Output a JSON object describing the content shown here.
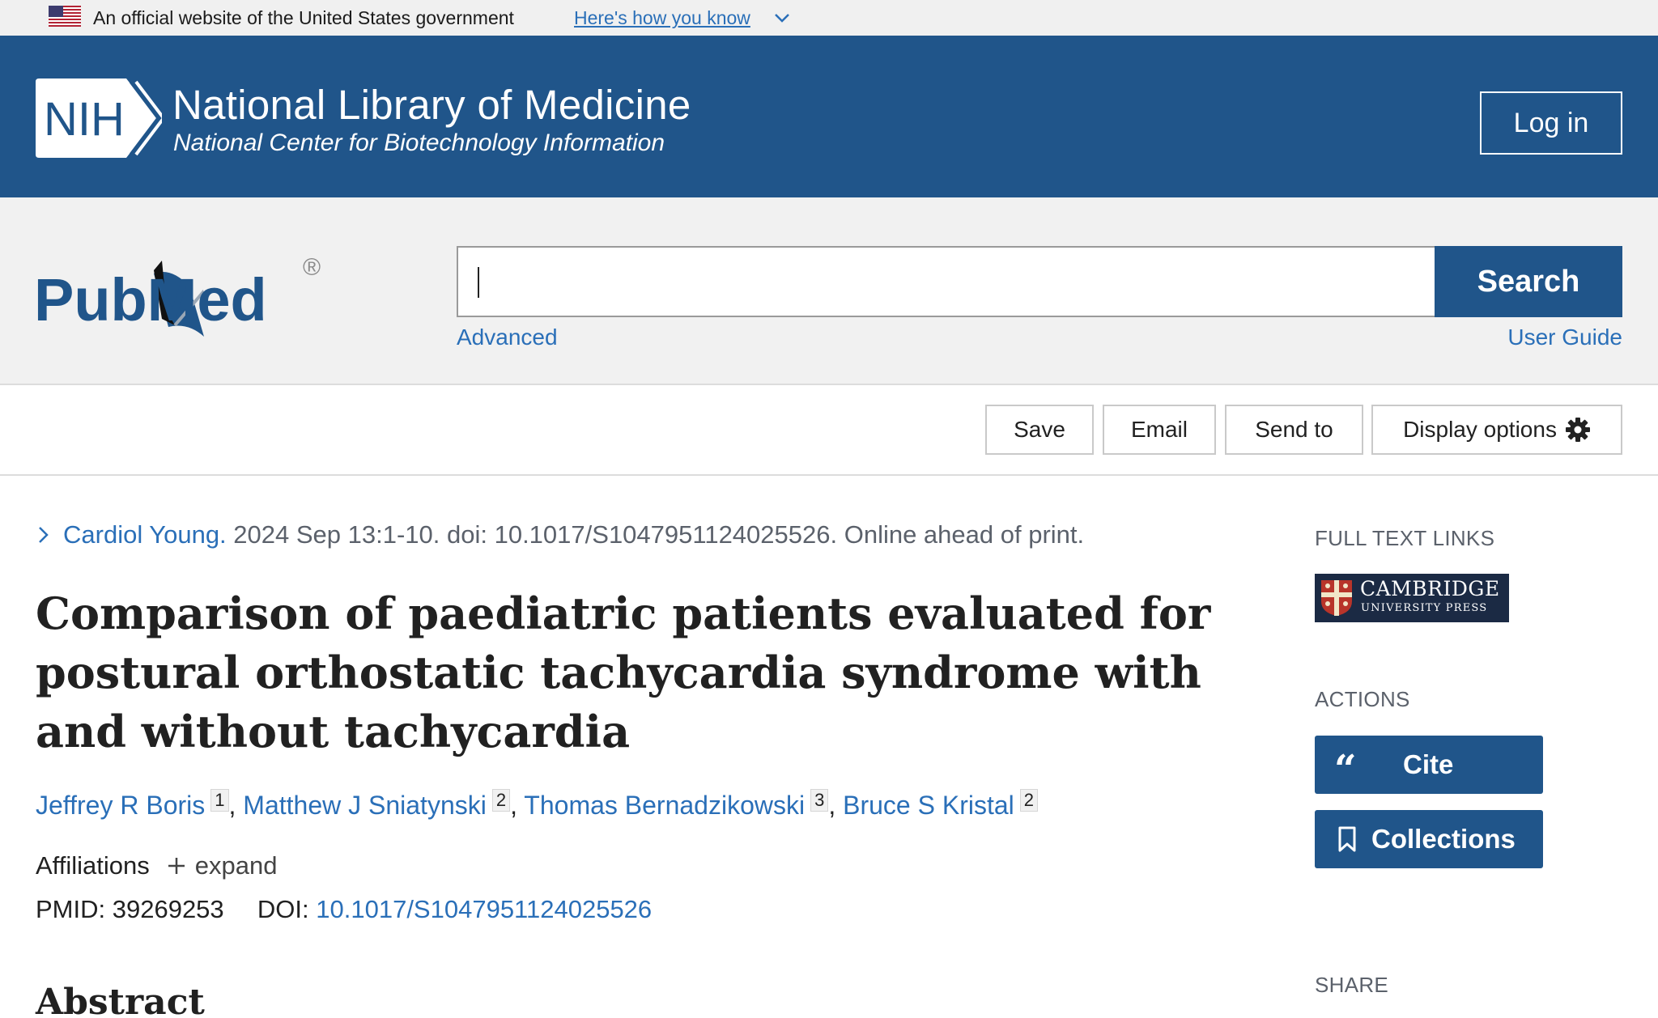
{
  "gov_banner": {
    "text": "An official website of the United States government",
    "link": "Here's how you know"
  },
  "nih_header": {
    "logo_text": "NIH",
    "title": "National Library of Medicine",
    "subtitle": "National Center for Biotechnology Information",
    "login_label": "Log in"
  },
  "search": {
    "logo_text": "PubMed",
    "registered_mark": "®",
    "input_value": "",
    "button_label": "Search",
    "advanced_link": "Advanced",
    "user_guide_link": "User Guide"
  },
  "toolbar": {
    "save": "Save",
    "email": "Email",
    "send_to": "Send to",
    "display_options": "Display options"
  },
  "article": {
    "journal": "Cardiol Young.",
    "citation_rest": " 2024 Sep 13:1-10. doi: 10.1017/S1047951124025526. Online ahead of print.",
    "title": "Comparison of paediatric patients evaluated for postural orthostatic tachycardia syndrome with and without tachycardia",
    "authors": [
      {
        "name": "Jeffrey R Boris",
        "aff": "1"
      },
      {
        "name": "Matthew J Sniatynski",
        "aff": "2"
      },
      {
        "name": "Thomas Bernadzikowski",
        "aff": "3"
      },
      {
        "name": "Bruce S Kristal",
        "aff": "2"
      }
    ],
    "affiliations_label": "Affiliations",
    "expand_label": "expand",
    "pmid_label": "PMID: ",
    "pmid": "39269253",
    "doi_label": "DOI: ",
    "doi": "10.1017/S1047951124025526",
    "abstract_heading": "Abstract"
  },
  "sidebar": {
    "full_text_links": "FULL TEXT LINKS",
    "publisher_line1": "CAMBRIDGE",
    "publisher_line2": "UNIVERSITY PRESS",
    "actions": "ACTIONS",
    "cite": "Cite",
    "collections": "Collections",
    "share": "SHARE"
  },
  "colors": {
    "nih_blue": "#20558a",
    "link_blue": "#2a6fb8",
    "banner_gray": "#f0f0f0"
  }
}
